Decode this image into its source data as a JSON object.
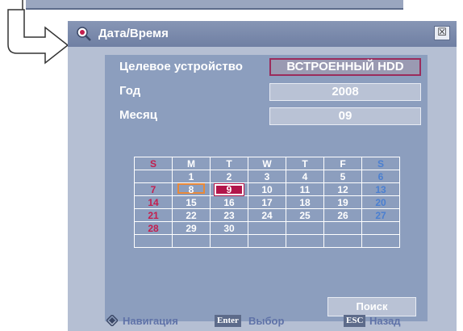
{
  "dialog": {
    "title": "Дата/Время",
    "close_symbol": "☒"
  },
  "form": {
    "device_label": "Целевое устройство",
    "device_value": "ВСТРОЕННЫЙ HDD",
    "year_label": "Год",
    "year_value": "2008",
    "month_label": "Месяц",
    "month_value": "09"
  },
  "calendar": {
    "weekdays": [
      "S",
      "M",
      "T",
      "W",
      "T",
      "F",
      "S"
    ],
    "weeks": [
      [
        "",
        "1",
        "2",
        "3",
        "4",
        "5",
        "6"
      ],
      [
        "7",
        "8",
        "9",
        "10",
        "11",
        "12",
        "13"
      ],
      [
        "14",
        "15",
        "16",
        "17",
        "18",
        "19",
        "20"
      ],
      [
        "21",
        "22",
        "23",
        "24",
        "25",
        "26",
        "27"
      ],
      [
        "28",
        "29",
        "30",
        "",
        "",
        "",
        ""
      ],
      [
        "",
        "",
        "",
        "",
        "",
        "",
        ""
      ]
    ],
    "highlighted_day": "8",
    "selected_day": "9"
  },
  "search_button": "Поиск",
  "footer": {
    "nav_label": "Навигация",
    "enter_key": "Enter",
    "enter_label": "Выбор",
    "esc_key": "ESC",
    "esc_label": "Назад"
  },
  "colors": {
    "sunday": "#c41e4e",
    "saturday": "#4a7fd1",
    "selected": "#b1154a",
    "highlight": "#e8893a"
  }
}
